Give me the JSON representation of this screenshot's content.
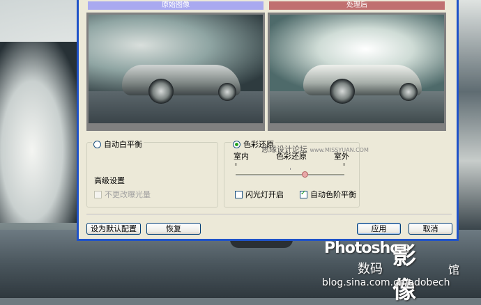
{
  "preview": {
    "original_label": "原始图像",
    "processed_label": "处理后"
  },
  "auto_white_balance": {
    "label": "自动白平衡",
    "selected": false
  },
  "advanced": {
    "title": "高级设置",
    "no_exposure_change": {
      "label": "不更改曝光量",
      "checked": false,
      "disabled": true
    }
  },
  "color_restore": {
    "label": "色彩还原",
    "selected": true,
    "slider": {
      "left_label": "室内",
      "center_label": "色彩还原",
      "right_label": "室外",
      "value_fraction": 0.64
    },
    "flash_on": {
      "label": "闪光灯开启",
      "checked": false
    },
    "auto_levels": {
      "label": "自动色阶平衡",
      "checked": true
    }
  },
  "buttons": {
    "set_default": "设为默认配置",
    "restore": "恢复",
    "apply": "应用",
    "cancel": "取消"
  },
  "watermark": {
    "cn": "思缘设计论坛",
    "url": "www.MISSYUAN.COM"
  },
  "logo": {
    "photoshop": "Photoshop",
    "yingxiang": "影像",
    "shuma": "数码",
    "guan": "馆",
    "blog": "blog.sina.com.cn/adobech"
  }
}
